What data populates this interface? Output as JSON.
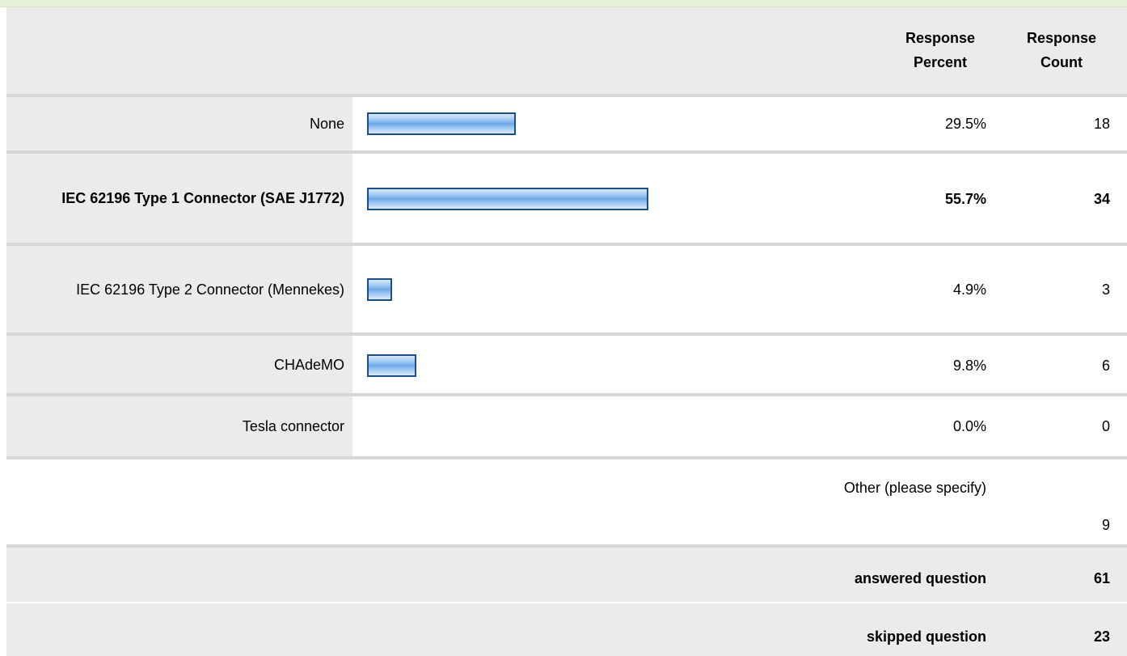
{
  "header": {
    "col_percent": "Response Percent",
    "col_count": "Response Count"
  },
  "chart_data": {
    "type": "bar",
    "orientation": "horizontal",
    "categories": [
      "None",
      "IEC 62196 Type 1 Connector (SAE J1772)",
      "IEC 62196 Type 2 Connector (Mennekes)",
      "CHAdeMO",
      "Tesla connector"
    ],
    "values": [
      29.5,
      55.7,
      4.9,
      9.8,
      0.0
    ],
    "percent_labels": [
      "29.5%",
      "55.7%",
      "4.9%",
      "9.8%",
      "0.0%"
    ],
    "counts": [
      "18",
      "34",
      "3",
      "6",
      "0"
    ],
    "highlighted_index": 1,
    "xlim": [
      0,
      100
    ],
    "bar_color": "#6ea8e8",
    "bar_border_color": "#1d4f86"
  },
  "other": {
    "label": "Other (please specify)",
    "count": "9"
  },
  "summary": {
    "answered_label": "answered question",
    "answered_count": "61",
    "skipped_label": "skipped question",
    "skipped_count": "23"
  }
}
